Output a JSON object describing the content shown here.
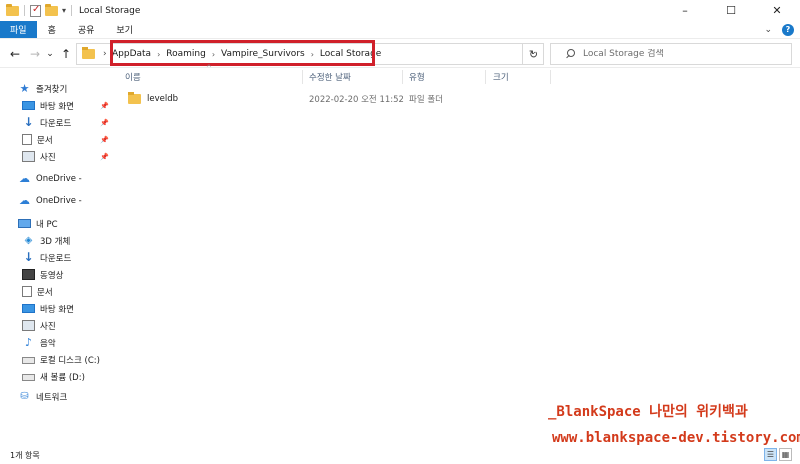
{
  "window": {
    "title": "Local Storage",
    "controls": {
      "minimize": "–",
      "maximize": "☐",
      "close": "✕"
    }
  },
  "ribbon": {
    "tabs": [
      "파일",
      "홈",
      "공유",
      "보기"
    ],
    "expand_glyph": "⌄",
    "help_glyph": "?"
  },
  "nav": {
    "back": "←",
    "forward": "→",
    "recent": "⌄",
    "up": "↑"
  },
  "address": {
    "root_chevron": "›",
    "separator": "›",
    "crumbs": [
      "AppData",
      "Roaming",
      "Vampire_Survivors",
      "Local Storage"
    ],
    "dropdown": "⌄",
    "refresh": "↻"
  },
  "search": {
    "placeholder": "Local Storage 검색"
  },
  "sidebar": {
    "quick_access": "즐겨찾기",
    "quick_items": [
      {
        "label": "바탕 화면",
        "icon": "desktop-icon"
      },
      {
        "label": "다운로드",
        "icon": "download-icon"
      },
      {
        "label": "문서",
        "icon": "document-icon"
      },
      {
        "label": "사진",
        "icon": "pictures-icon"
      }
    ],
    "pin_glyph": "📌",
    "onedrive_1": "OneDrive -",
    "onedrive_2": "OneDrive -",
    "this_pc": "내 PC",
    "pc_items": [
      {
        "label": "3D 개체",
        "icon": "3d-objects-icon"
      },
      {
        "label": "다운로드",
        "icon": "download-icon"
      },
      {
        "label": "동영상",
        "icon": "video-icon"
      },
      {
        "label": "문서",
        "icon": "document-icon"
      },
      {
        "label": "바탕 화면",
        "icon": "desktop-icon"
      },
      {
        "label": "사진",
        "icon": "pictures-icon"
      },
      {
        "label": "음악",
        "icon": "music-icon"
      },
      {
        "label": "로컬 디스크 (C:)",
        "icon": "disk-icon"
      },
      {
        "label": "새 볼륨 (D:)",
        "icon": "disk-icon"
      }
    ],
    "network": "네트워크"
  },
  "columns": {
    "name": "이름",
    "modified": "수정한 날짜",
    "type": "유형",
    "size": "크기",
    "sort_glyph": "^"
  },
  "files": [
    {
      "name": "leveldb",
      "modified": "2022-02-20 오전 11:52",
      "type": "파일 폴더",
      "size": ""
    }
  ],
  "status": {
    "count": "1개 항목"
  },
  "watermark": {
    "line1": "_BlankSpace 나만의 위키백과",
    "line2": "www.blankspace-dev.tistory.com"
  },
  "colors": {
    "accent": "#1979ca",
    "highlight_box": "#d0202a",
    "watermark": "#d33a1b",
    "folder": "#f3c24e"
  }
}
